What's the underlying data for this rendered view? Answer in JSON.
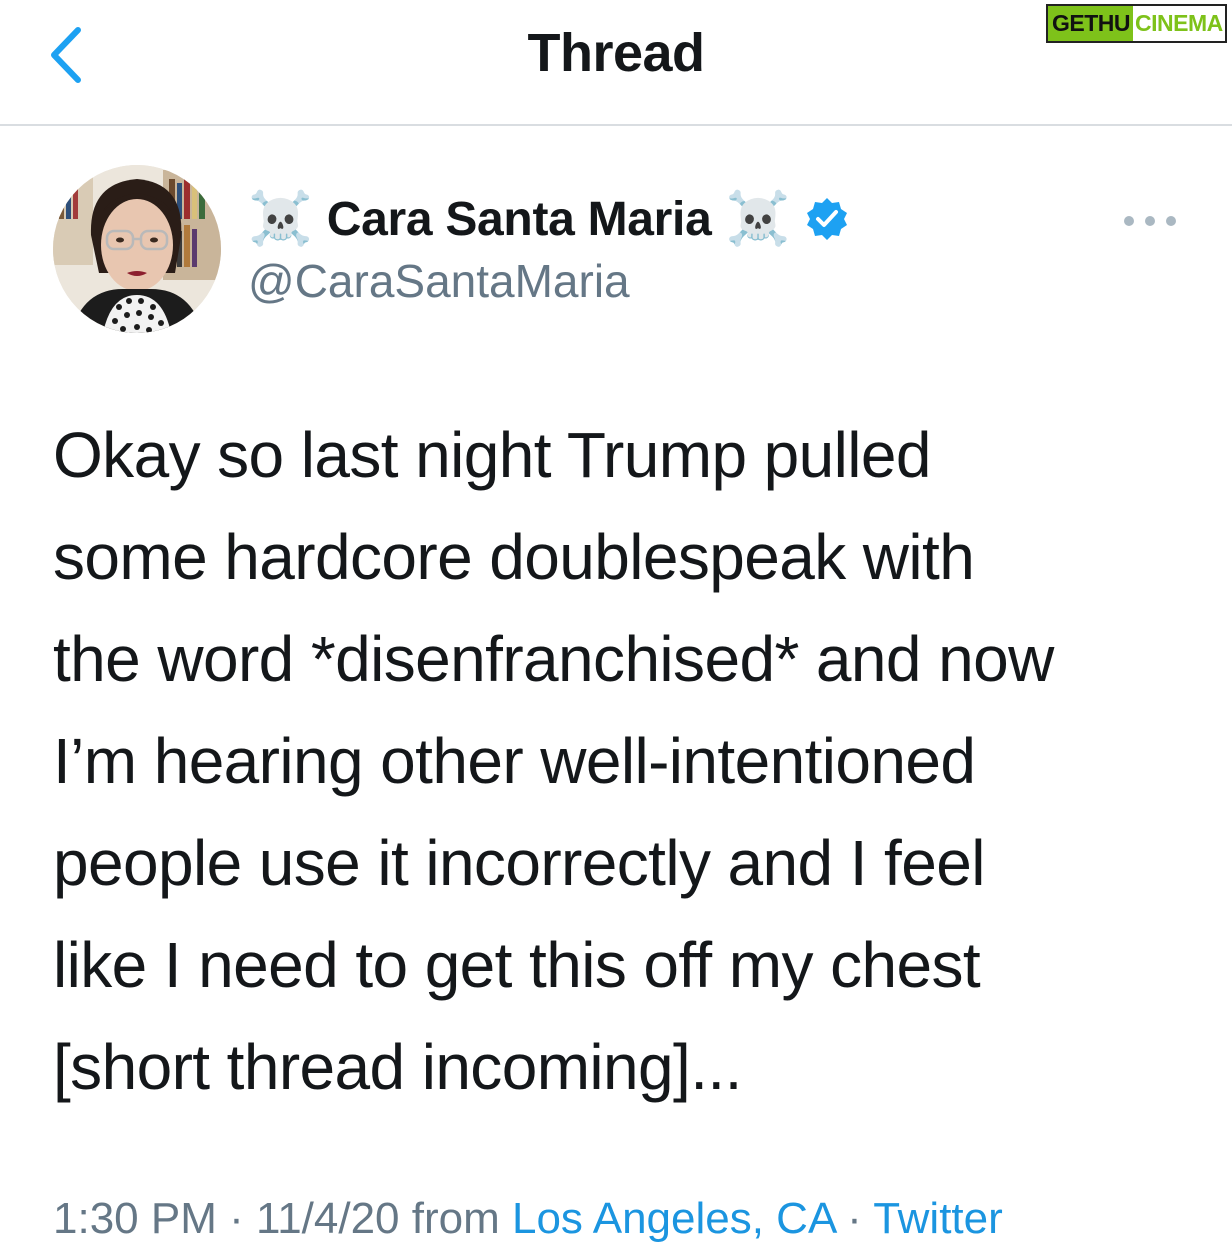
{
  "header": {
    "title": "Thread",
    "watermark": {
      "part1": "GETHU",
      "part2": "CINEMA"
    }
  },
  "tweet": {
    "author": {
      "emoji_left": "☠️",
      "display_name": "Cara Santa Maria",
      "emoji_right": "☠️",
      "handle": "@CaraSantaMaria",
      "verified": true
    },
    "text": "Okay so last night Trump pulled\nsome hardcore doublespeak with\nthe word *disenfranchised* and now\nI’m hearing other well-intentioned\npeople use it incorrectly and I feel\nlike I need to get this off my chest\n[short thread incoming]...",
    "meta": {
      "time": "1:30 PM",
      "sep": " · ",
      "date": "11/4/20",
      "from": " from ",
      "location": "Los Angeles, CA",
      "source": "Twitter"
    }
  },
  "colors": {
    "accent": "#1da1f2",
    "secondary_text": "#657786",
    "primary_text": "#14171a",
    "divider": "#d9dde1"
  },
  "icons": {
    "back": "chevron-left-icon",
    "more": "more-horizontal-icon",
    "verified": "verified-badge-icon"
  }
}
